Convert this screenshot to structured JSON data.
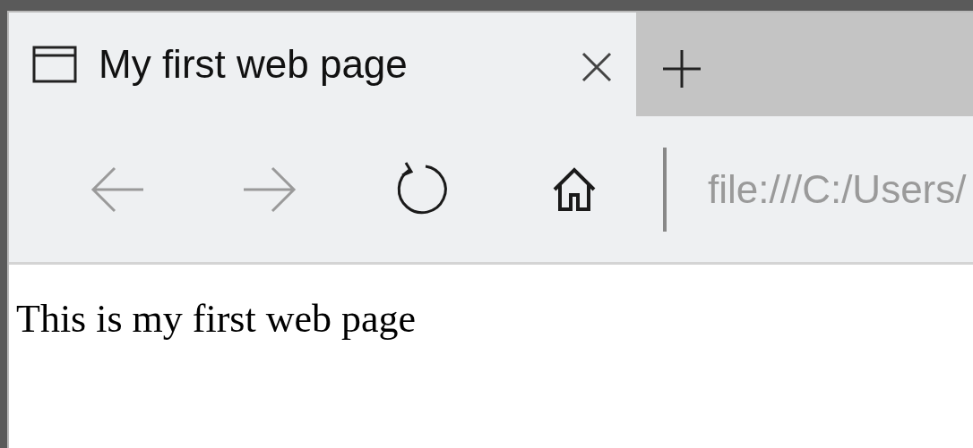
{
  "tabs": [
    {
      "title": "My first web page",
      "selected": true
    }
  ],
  "nav_buttons": [
    {
      "kind": "back",
      "disabled": true
    },
    {
      "kind": "forward",
      "disabled": true
    },
    {
      "kind": "refresh",
      "disabled": false
    },
    {
      "kind": "home",
      "disabled": false
    }
  ],
  "address_bar": {
    "value": "file:///C:/Users/"
  },
  "page": {
    "text": "This is my first web page"
  }
}
